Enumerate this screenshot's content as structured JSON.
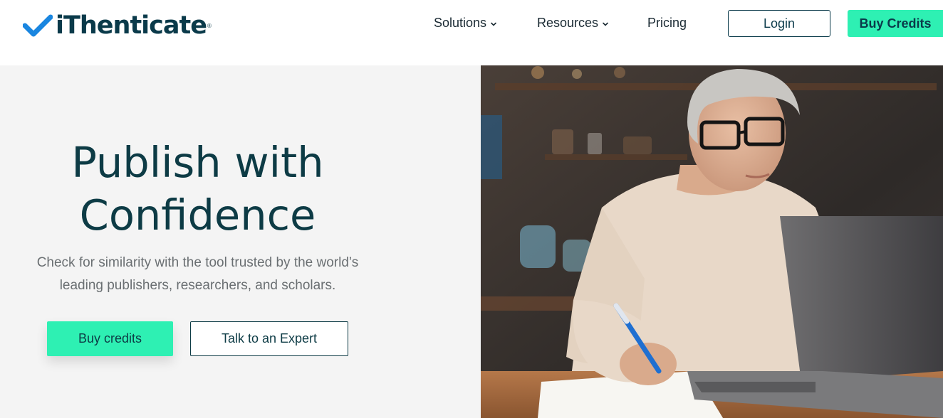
{
  "header": {
    "logo_text": "iThenticate",
    "logo_mark": "®",
    "nav": {
      "solutions": "Solutions",
      "resources": "Resources",
      "pricing": "Pricing"
    },
    "login_label": "Login",
    "buy_label": "Buy Credits"
  },
  "hero": {
    "title_line1": "Publish with",
    "title_line2": "Confidence",
    "subtitle_line1": "Check for similarity with the tool trusted by the world’s",
    "subtitle_line2": "leading publishers, researchers, and scholars.",
    "primary_button": "Buy credits",
    "secondary_button": "Talk to an Expert"
  },
  "colors": {
    "brand_dark": "#0a3a4a",
    "accent": "#2ef0b3",
    "check_blue": "#1a86e0",
    "hero_bg": "#f4f4f4"
  },
  "icons": {
    "logo": "checkmark-icon",
    "nav_chevron": "chevron-down-icon"
  }
}
